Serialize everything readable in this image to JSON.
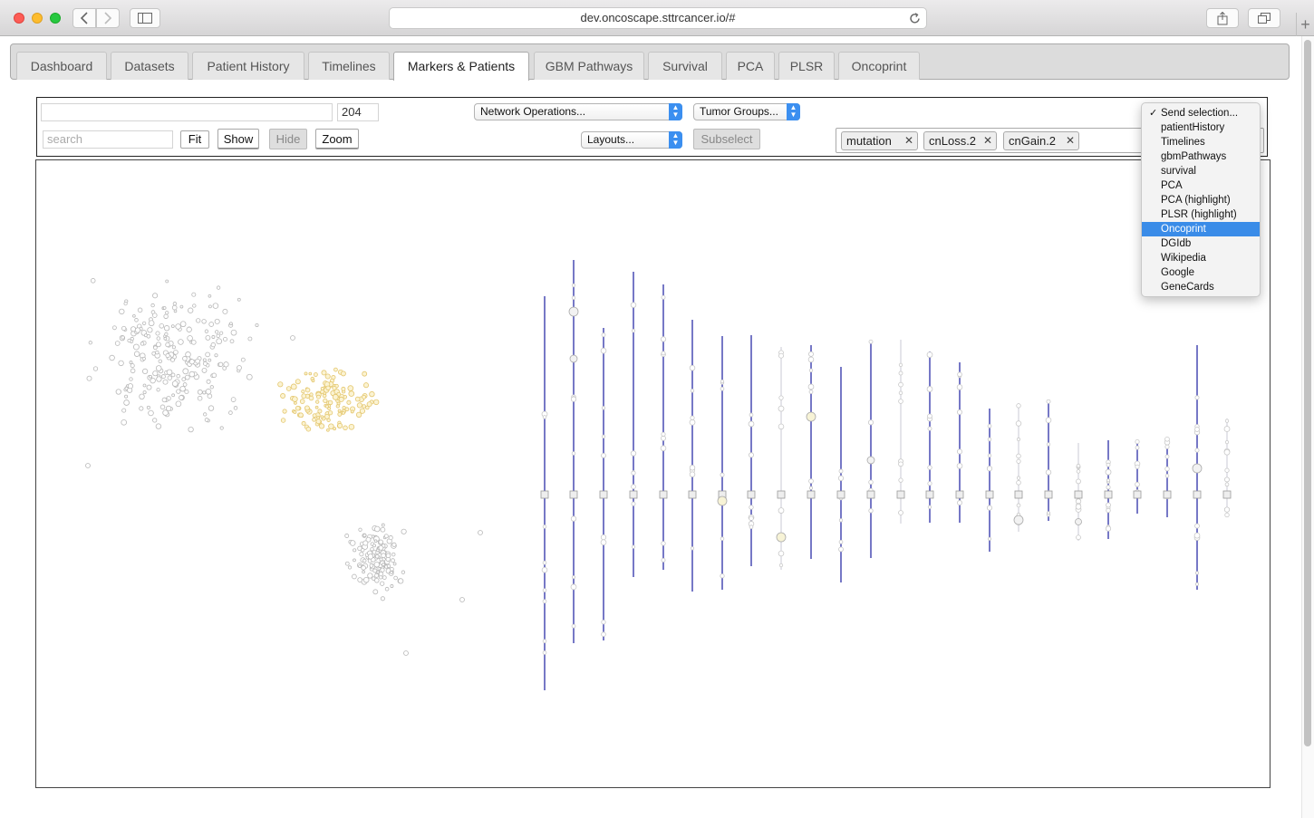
{
  "browser": {
    "url": "dev.oncoscape.sttrcancer.io/#",
    "new_tab": "+"
  },
  "tabs": [
    {
      "label": "Dashboard"
    },
    {
      "label": "Datasets"
    },
    {
      "label": "Patient History"
    },
    {
      "label": "Timelines"
    },
    {
      "label": "Markers & Patients",
      "active": true
    },
    {
      "label": "GBM Pathways"
    },
    {
      "label": "Survival"
    },
    {
      "label": "PCA"
    },
    {
      "label": "PLSR"
    },
    {
      "label": "Oncoprint"
    }
  ],
  "controls": {
    "count_value": "204",
    "search_placeholder": "search",
    "fit_label": "Fit",
    "show_label": "Show",
    "hide_label": "Hide",
    "zoom_label": "Zoom",
    "network_ops": "Network Operations...",
    "tumor_groups": "Tumor Groups...",
    "layouts": "Layouts...",
    "subselect": "Subselect",
    "tags": [
      "mutation",
      "cnLoss.2",
      "cnGain.2"
    ]
  },
  "send_menu": {
    "checkmark": "✓",
    "items": [
      "Send selection...",
      "patientHistory",
      "Timelines",
      "gbmPathways",
      "survival",
      "PCA",
      "PCA (highlight)",
      "PLSR (highlight)",
      "Oncoprint",
      "DGIdb",
      "Wikipedia",
      "Google",
      "GeneCards"
    ],
    "checked": "Send selection...",
    "highlighted": "Oncoprint"
  },
  "colors": {
    "edge_blue": "#2d2fa8",
    "node_gray": "#b8b8b8",
    "node_yellow": "#f1dc8a",
    "menu_highlight": "#3a8ce8"
  }
}
